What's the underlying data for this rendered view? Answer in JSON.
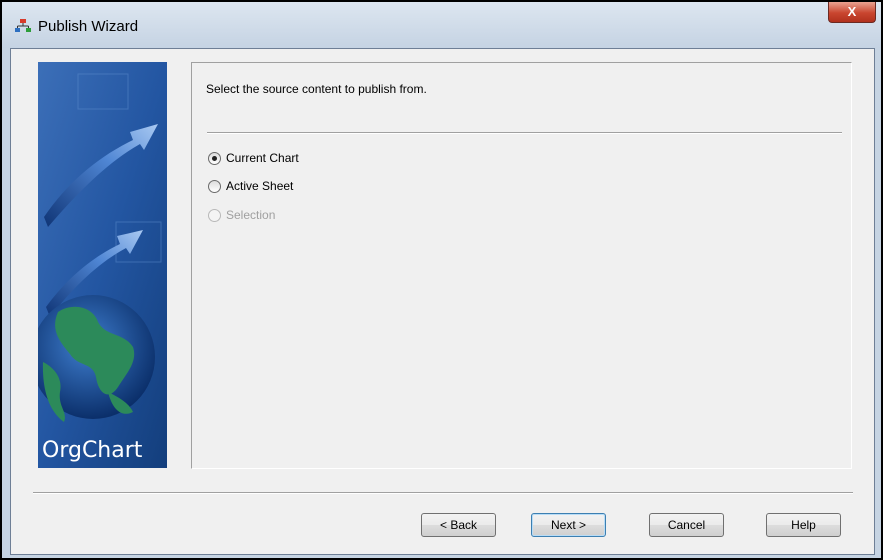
{
  "window": {
    "title": "Publish Wizard",
    "close_glyph": "X"
  },
  "banner": {
    "brand": "OrgChart"
  },
  "page": {
    "prompt": "Select the source content to publish from."
  },
  "source_options": [
    {
      "label": "Current Chart",
      "selected": true,
      "enabled": true
    },
    {
      "label": "Active Sheet",
      "selected": false,
      "enabled": true
    },
    {
      "label": "Selection",
      "selected": false,
      "enabled": false
    }
  ],
  "buttons": {
    "back": "< Back",
    "next": "Next >",
    "cancel": "Cancel",
    "help": "Help"
  },
  "colors": {
    "banner_blue": "#1f4f93",
    "close_red": "#c9452f",
    "frame": "#f0f0f0"
  }
}
